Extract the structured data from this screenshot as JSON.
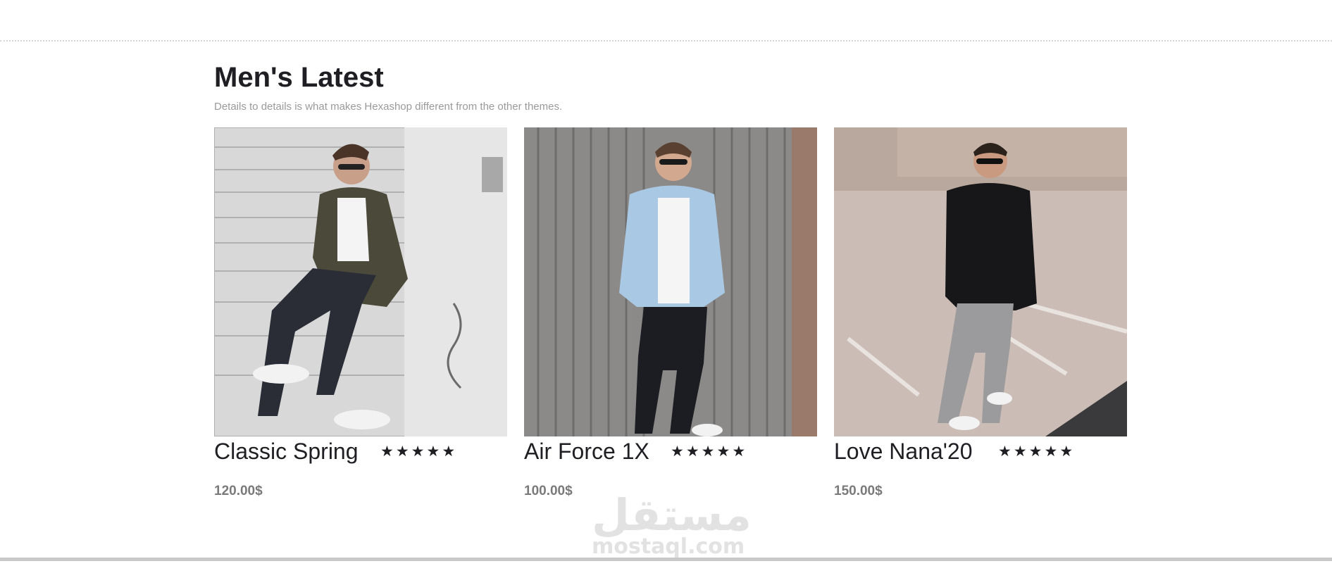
{
  "section": {
    "title": "Men's Latest",
    "subtitle": "Details to details is what makes Hexashop different from the other themes."
  },
  "products": [
    {
      "name": "Classic Spring",
      "price": "120.00$",
      "rating": 5,
      "stars": [
        "★",
        "★",
        "★",
        "★",
        "★"
      ],
      "image_icon": "man-camo-jacket-photo"
    },
    {
      "name": "Air Force 1X",
      "price": "100.00$",
      "rating": 5,
      "stars": [
        "★",
        "★",
        "★",
        "★",
        "★"
      ],
      "image_icon": "man-denim-jacket-photo"
    },
    {
      "name": "Love Nana'20",
      "price": "150.00$",
      "rating": 5,
      "stars": [
        "★",
        "★",
        "★",
        "★",
        "★"
      ],
      "image_icon": "man-black-sweater-photo"
    }
  ],
  "watermark": {
    "arabic": "مستقل",
    "latin": "mostaql.com"
  },
  "colors": {
    "title": "#1f1f23",
    "subtitle": "#9a9a9a",
    "price": "#7a7a7a",
    "star": "#1f1f23",
    "divider": "#d8d8d8"
  }
}
